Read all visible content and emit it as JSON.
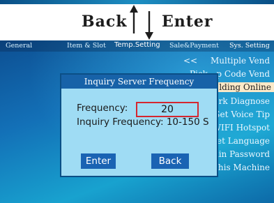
{
  "nav": {
    "back": "Back",
    "enter": "Enter"
  },
  "tabs": [
    "General",
    "Item & Slot",
    "Temp.Setting",
    "Sale&Payment",
    "Sys. Setting"
  ],
  "menu": {
    "back_symbol": "<<",
    "items": [
      "Multiple Vend",
      "Pickup Code Vend",
      "Building Online",
      "Network Diagnose",
      "Set Voice Tip",
      "WIFI Hotspot",
      "Set Language",
      "Admin Password",
      "About This Machine"
    ],
    "visible_text": [
      "Multiple Vend",
      "Pick",
      "p Code Vend",
      "lding Online",
      "rk Diagnose",
      "Set Voice Tip",
      "WIFI Hotspot",
      "Set Language",
      "hin Password",
      "This Machine"
    ],
    "selected_index": 2
  },
  "dialog": {
    "title": "Inquiry Server Frequency",
    "frequency_label": "Frequency:",
    "frequency_value": "20",
    "range_label": "Inquiry Frequency: 10-150 S",
    "enter_label": "Enter",
    "back_label": "Back"
  },
  "colors": {
    "screen_bg": "#1370b7",
    "dialog_bg": "#9fdcf4",
    "dialog_title_bg": "#1762a8",
    "button_bg": "#1a63b3",
    "selected_item_bg": "#fbe9c8",
    "input_border": "#d5262f"
  },
  "icons": [
    "arrow-up-icon",
    "arrow-down-icon"
  ]
}
